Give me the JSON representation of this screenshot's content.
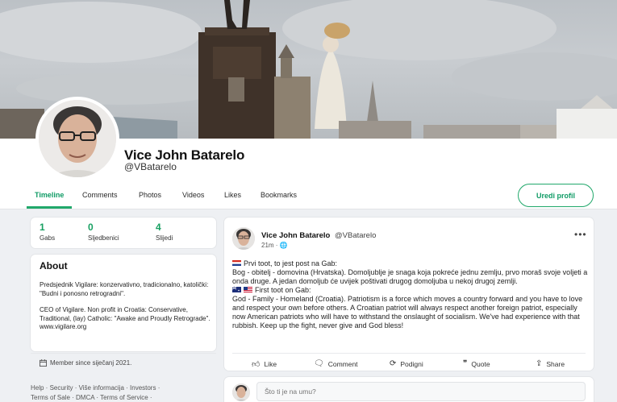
{
  "profile": {
    "display_name": "Vice John Batarelo",
    "handle": "@VBatarelo",
    "edit_button": "Uredi profil"
  },
  "tabs": [
    {
      "label": "Timeline",
      "active": true
    },
    {
      "label": "Comments",
      "active": false
    },
    {
      "label": "Photos",
      "active": false
    },
    {
      "label": "Videos",
      "active": false
    },
    {
      "label": "Likes",
      "active": false
    },
    {
      "label": "Bookmarks",
      "active": false
    }
  ],
  "stats": [
    {
      "value": "1",
      "label": "Gabs"
    },
    {
      "value": "0",
      "label": "Sljedbenici"
    },
    {
      "value": "4",
      "label": "Slijedi"
    }
  ],
  "about": {
    "title": "About",
    "bio_1": "Predsjednik Vigilare: konzervativno, tradicionalno, katolički: \"Budni i ponosno retrogradni\".",
    "bio_2": "CEO of Vigilare. Non profit in Croatia: Conservative, Traditional, (lay) Catholic: \"Awake and Proudly Retrograde\".",
    "website": "www.vigilare.org",
    "member_since": "Member since siječanj 2021."
  },
  "footer_links": [
    "Help",
    "Security",
    "Više informacija",
    "Investors",
    "Terms of Sale",
    "DMCA",
    "Terms of Service"
  ],
  "post": {
    "author": "Vice John Batarelo",
    "handle": "@VBatarelo",
    "time": "21m",
    "more": "•••",
    "hr_head": "Prvi toot, to jest post na Gab:",
    "hr_body": "Bog - obitelj - domovina (Hrvatska). Domoljublje je snaga koja pokreće jednu zemlju, prvo moraš svoje voljeti a onda druge. A jedan domoljub će uvijek poštivati drugog domoljuba u nekoj drugoj zemlji.",
    "en_head": "First toot on Gab:",
    "en_body": "God - Family - Homeland (Croatia). Patriotism is a force which moves a country forward and you have to love and respect your own before others. A Croatian patriot will always respect another foreign patriot, especially now American patriots who will have to withstand the onslaught of socialism. We've had experience with that rubbish. Keep up the fight, never give and God bless!",
    "actions": {
      "like": "Like",
      "comment": "Comment",
      "repost": "Podigni",
      "quote": "Quote",
      "share": "Share"
    }
  },
  "compose": {
    "placeholder": "Što ti je na umu?"
  },
  "colors": {
    "accent": "#21a86b",
    "background": "#eef0f3"
  }
}
